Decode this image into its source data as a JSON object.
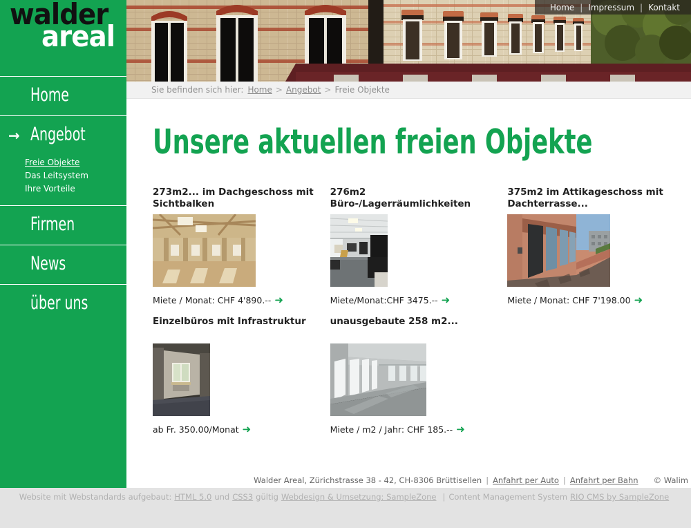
{
  "site": {
    "logo_line1": "walder",
    "logo_line2": "areal",
    "brand_green": "#13a351"
  },
  "topnav": {
    "items": [
      {
        "label": "Home"
      },
      {
        "label": "Impressum"
      },
      {
        "label": "Kontakt"
      }
    ],
    "separator": "|"
  },
  "sidebar": {
    "items": [
      {
        "label": "Home",
        "active": false
      },
      {
        "label": "Angebot",
        "active": true
      },
      {
        "label": "Firmen",
        "active": false
      },
      {
        "label": "News",
        "active": false
      },
      {
        "label": "über uns",
        "active": false
      }
    ],
    "subitems": [
      {
        "label": "Freie Objekte",
        "active": true
      },
      {
        "label": "Das Leitsystem",
        "active": false
      },
      {
        "label": "Ihre Vorteile",
        "active": false
      }
    ],
    "active_marker": "→"
  },
  "breadcrumb": {
    "prefix": "Sie befinden sich hier:",
    "items": [
      {
        "label": "Home",
        "link": true
      },
      {
        "label": "Angebot",
        "link": true
      },
      {
        "label": "Freie Objekte",
        "link": false
      }
    ],
    "separator": ">"
  },
  "main": {
    "title": "Unsere aktuellen freien Objekte",
    "objects": [
      {
        "title": "273m2... im Dachgeschoss mit Sichtbalken",
        "price": "Miete / Monat: CHF 4'890.--",
        "arrow": "➜",
        "image_name": "attic-loft-with-wooden-beams"
      },
      {
        "title": "276m2 Büro-/Lagerräumlichkeiten",
        "price": "Miete/Monat:CHF 3475.--",
        "arrow": "➜",
        "image_name": "open-plan-office-interior"
      },
      {
        "title": "375m2 im Attikageschoss mit Dachterrasse...",
        "price": "Miete / Monat: CHF 7'198.00",
        "arrow": "➜",
        "image_name": "rooftop-terrace-walkway"
      },
      {
        "title": "Einzelbüros mit Infrastruktur",
        "price": "ab Fr. 350.00/Monat",
        "arrow": "➜",
        "image_name": "small-single-office-room"
      },
      {
        "title": "unausgebaute 258 m2...",
        "price": "Miete / m2 / Jahr: CHF 185.--",
        "arrow": "➜",
        "image_name": "empty-unfinished-hall"
      }
    ]
  },
  "footer": {
    "address": "Walder Areal, Zürichstrasse 38 - 42, CH-8306 Brüttisellen",
    "links": [
      {
        "label": "Anfahrt per Auto"
      },
      {
        "label": "Anfahrt per Bahn"
      }
    ],
    "separator": "|",
    "copyright": "© Walim"
  },
  "bottombar": {
    "text_1": "Website mit Webstandards aufgebaut:",
    "link_html": "HTML 5.0",
    "text_2": "und",
    "link_css": "CSS3",
    "text_3": "gültig",
    "link_webdesign": "Webdesign & Umsetzung: SampleZone",
    "separator": "|",
    "text_4": "Content Management System",
    "link_cms": "RIO CMS by SampleZone"
  }
}
